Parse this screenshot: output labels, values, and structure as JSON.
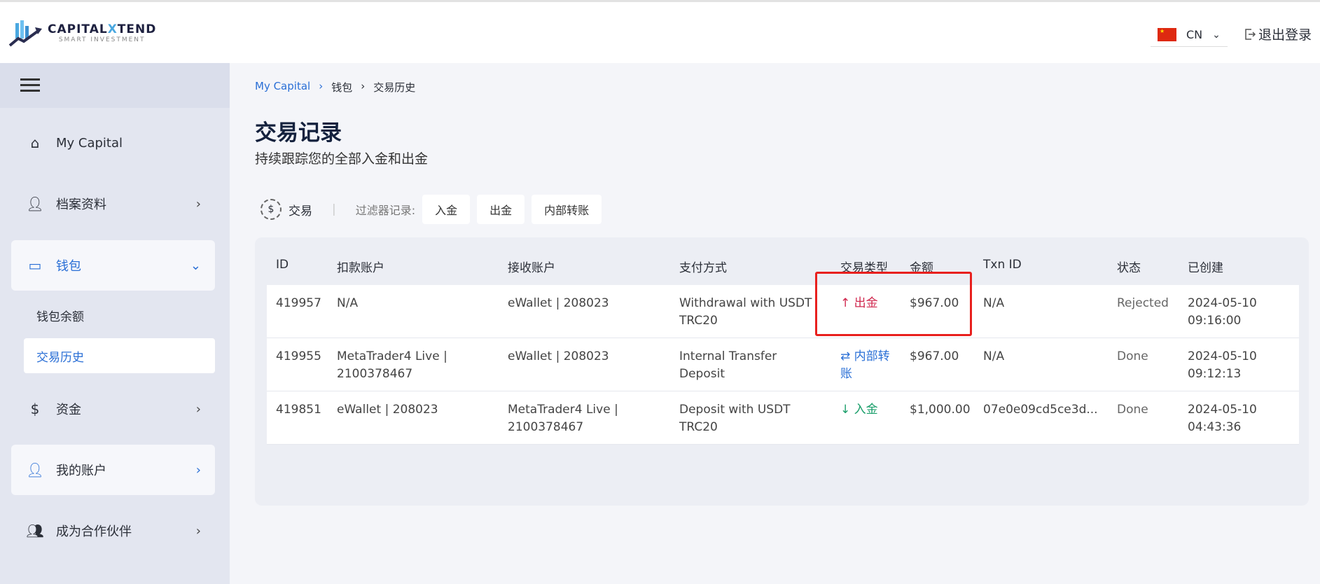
{
  "header": {
    "logo_main": "CAPITAL",
    "logo_x": "X",
    "logo_end": "TEND",
    "logo_sub": "SMART INVESTMENT",
    "lang": "CN",
    "logout": "退出登录"
  },
  "sidebar": {
    "items": [
      {
        "label": "My Capital",
        "icon": "home-chart-icon"
      },
      {
        "label": "档案资料",
        "icon": "user-icon"
      },
      {
        "label": "钱包",
        "icon": "wallet-icon"
      },
      {
        "label": "资金",
        "icon": "money-hand-icon"
      },
      {
        "label": "我的账户",
        "icon": "user-chart-icon"
      },
      {
        "label": "成为合作伙伴",
        "icon": "group-icon"
      }
    ],
    "sub": [
      "钱包余额",
      "交易历史"
    ]
  },
  "breadcrumb": [
    "My Capital",
    "钱包",
    "交易历史"
  ],
  "page": {
    "title": "交易记录",
    "subtitle": "持续跟踪您的全部入金和出金"
  },
  "filters": {
    "tab": "交易",
    "label": "过滤器记录:",
    "buttons": [
      "入金",
      "出金",
      "内部转账"
    ]
  },
  "table": {
    "headers": [
      "ID",
      "扣款账户",
      "接收账户",
      "支付方式",
      "交易类型",
      "金额",
      "Txn ID",
      "状态",
      "已创建"
    ],
    "rows": [
      {
        "id": "419957",
        "from": "N/A",
        "to": "eWallet | 208023",
        "method": "Withdrawal with USDT TRC20",
        "type": "出金",
        "type_icon": "↑",
        "type_color": "#d0294f",
        "amount": "$967.00",
        "txn": "N/A",
        "status": "Rejected",
        "date": "2024-05-10",
        "time": "09:16:00"
      },
      {
        "id": "419955",
        "from": "MetaTrader4 Live | 2100378467",
        "to": "eWallet | 208023",
        "method": "Internal Transfer Deposit",
        "type": "内部转账",
        "type_icon": "⇄",
        "type_color": "#2a6fd6",
        "amount": "$967.00",
        "txn": "N/A",
        "status": "Done",
        "date": "2024-05-10",
        "time": "09:12:13"
      },
      {
        "id": "419851",
        "from": "eWallet | 208023",
        "to": "MetaTrader4 Live | 2100378467",
        "method": "Deposit with USDT TRC20",
        "type": "入金",
        "type_icon": "↓",
        "type_color": "#1a9e6a",
        "amount": "$1,000.00",
        "txn": "07e0e09cd5ce3d...",
        "status": "Done",
        "date": "2024-05-10",
        "time": "04:43:36"
      }
    ]
  }
}
